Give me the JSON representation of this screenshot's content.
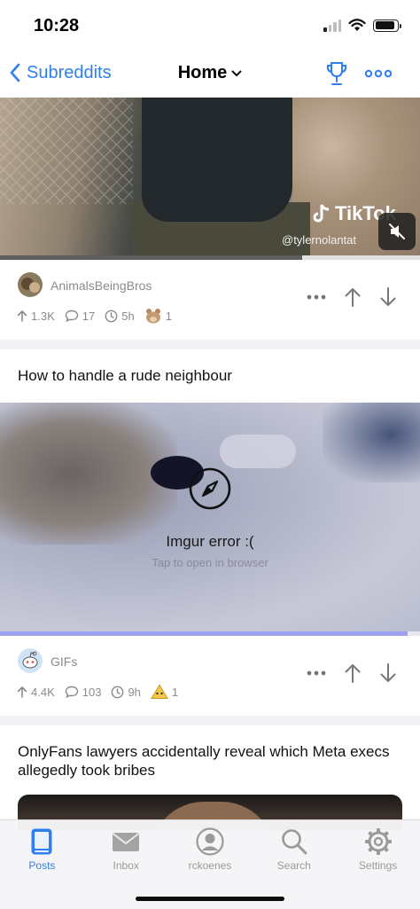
{
  "status_bar": {
    "time": "10:28"
  },
  "nav": {
    "back_label": "Subreddits",
    "title": "Home",
    "accent_color": "#2f7ff0"
  },
  "posts": [
    {
      "media": {
        "type": "video",
        "watermark_brand": "TikTok",
        "watermark_handle": "@tylernolantat",
        "muted": true,
        "progress": 0.72
      },
      "subreddit": "AnimalsBeingBros",
      "upvotes": "1.3K",
      "comments": "17",
      "age": "5h",
      "awards": "1"
    },
    {
      "title": "How to handle a rude neighbour",
      "media": {
        "type": "imgur",
        "error_text": "Imgur error :(",
        "hint_text": "Tap to open in browser",
        "progress": 0.97
      },
      "subreddit": "GIFs",
      "upvotes": "4.4K",
      "comments": "103",
      "age": "9h",
      "awards": "1"
    },
    {
      "title": "OnlyFans lawyers accidentally reveal which Meta execs allegedly took bribes"
    }
  ],
  "tab_bar": {
    "tabs": [
      {
        "label": "Posts",
        "icon": "posts-icon",
        "active": true
      },
      {
        "label": "Inbox",
        "icon": "envelope-icon",
        "active": false
      },
      {
        "label": "rckoenes",
        "icon": "profile-icon",
        "active": false
      },
      {
        "label": "Search",
        "icon": "search-icon",
        "active": false
      },
      {
        "label": "Settings",
        "icon": "gear-icon",
        "active": false
      }
    ]
  }
}
